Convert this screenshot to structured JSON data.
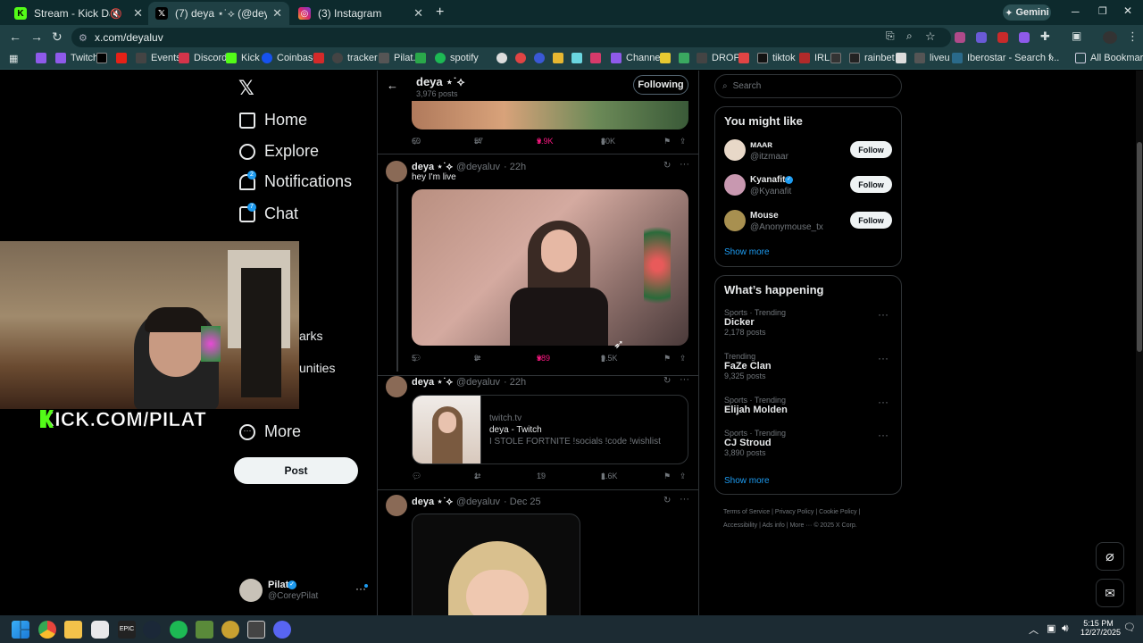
{
  "browser": {
    "tabs": [
      {
        "title": "Stream - Kick Dashboard",
        "icon": "kick-icon",
        "active": false
      },
      {
        "title": "(7) deya ⋆˙⟡ (@deyaluv) / X",
        "icon": "x-icon",
        "active": true
      },
      {
        "title": "(3) Instagram",
        "icon": "instagram-icon",
        "active": false
      }
    ],
    "new_tab": "+",
    "gemini_label": "Gemini",
    "url": "x.com/deyaluv",
    "bookmarks": [
      "Twitch",
      "Events",
      "Discord",
      "Kick",
      "Coinbase",
      "tracker",
      "Pilat.",
      "spotify",
      "Channel",
      "DROP",
      "tiktok",
      "IRL",
      "rainbet",
      "liveu",
      "Iberostar - Search f..."
    ],
    "all_bookmarks": "All Bookmarks",
    "more_bookmarks": "»"
  },
  "sidebar": {
    "items": [
      {
        "label": "Home",
        "icon": "home-icon"
      },
      {
        "label": "Explore",
        "icon": "search-icon"
      },
      {
        "label": "Notifications",
        "icon": "bell-icon",
        "badge": "2"
      },
      {
        "label": "Chat",
        "icon": "mail-icon",
        "badge": "7"
      },
      {
        "label": "More",
        "icon": "more-circle-icon"
      }
    ],
    "partial_items": [
      "m",
      "arks",
      "unities"
    ],
    "post_label": "Post",
    "account": {
      "name": "Pilat",
      "handle": "@CoreyPilat"
    }
  },
  "overlay": {
    "kick_text": "KICK.COM/PILAT",
    "accent": "#53fc18"
  },
  "profile_header": {
    "name": "deya ⋆˙⟡",
    "posts_count": "3,976 posts",
    "following_label": "Following"
  },
  "posts": [
    {
      "stats": {
        "replies": "60",
        "reposts": "57",
        "likes": "3.9K",
        "views": "80K"
      }
    },
    {
      "name": "deya ⋆˙⟡",
      "handle": "@deyaluv",
      "time": "· 22h",
      "text": "hey I'm live",
      "stats": {
        "replies": "5",
        "reposts": "9",
        "likes": "389",
        "views": "9.5K"
      }
    },
    {
      "name": "deya ⋆˙⟡",
      "handle": "@deyaluv",
      "time": "· 22h",
      "card": {
        "domain": "twitch.tv",
        "title": "deya - Twitch",
        "desc": "I STOLE FORTNITE !socials !code !wishlist"
      },
      "stats": {
        "replies": "",
        "reposts": "1",
        "likes": "19",
        "views": "1.6K"
      }
    },
    {
      "name": "deya ⋆˙⟡",
      "handle": "@deyaluv",
      "time": "· Dec 25"
    }
  ],
  "right": {
    "search_placeholder": "Search",
    "you_might_like": {
      "title": "You might like",
      "users": [
        {
          "name": "ᴍᴀᴀʀ",
          "handle": "@itzmaar",
          "follow": "Follow"
        },
        {
          "name": "Kyanafit",
          "handle": "@Kyanafit",
          "follow": "Follow"
        },
        {
          "name": "Mouse",
          "handle": "@Anonymouse_tx",
          "follow": "Follow"
        }
      ],
      "show_more": "Show more"
    },
    "whats_happening": {
      "title": "What’s happening",
      "trends": [
        {
          "meta": "Sports · Trending",
          "name": "Dicker",
          "count": "2,178 posts"
        },
        {
          "meta": "Trending",
          "name": "FaZe Clan",
          "count": "9,325 posts"
        },
        {
          "meta": "Sports · Trending",
          "name": "Elijah Molden",
          "count": ""
        },
        {
          "meta": "Sports · Trending",
          "name": "CJ Stroud",
          "count": "3,890 posts"
        }
      ],
      "show_more": "Show more"
    },
    "footer": [
      "Terms of Service",
      "Privacy Policy",
      "Cookie Policy",
      "Accessibility",
      "Ads info",
      "More ···",
      "© 2025 X Corp."
    ]
  },
  "taskbar": {
    "time": "5:15 PM",
    "date": "12/27/2025"
  }
}
